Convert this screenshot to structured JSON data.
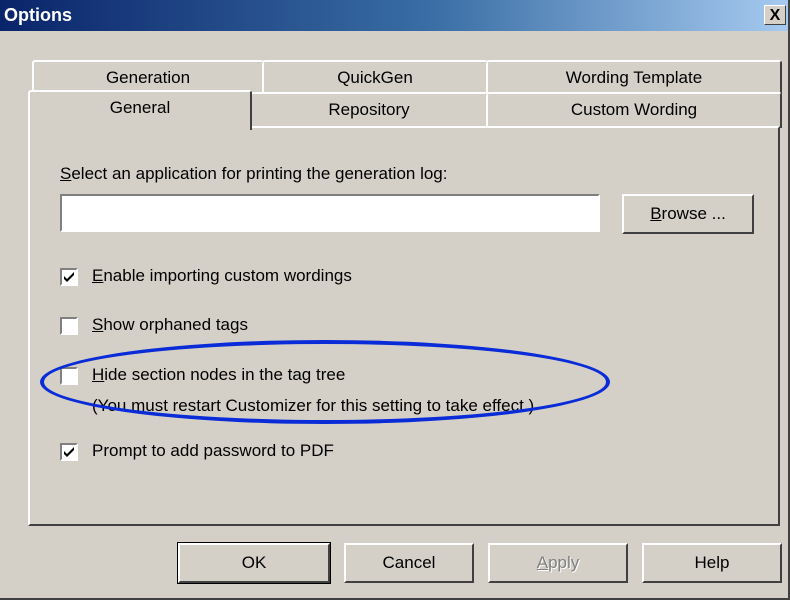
{
  "window": {
    "title": "Options",
    "close_label": "X"
  },
  "tabs": {
    "row1": [
      {
        "label": "Generation"
      },
      {
        "label": "QuickGen"
      },
      {
        "label": "Wording Template"
      }
    ],
    "row2": [
      {
        "label": "General",
        "active": true
      },
      {
        "label": "Repository"
      },
      {
        "label": "Custom Wording"
      }
    ]
  },
  "general": {
    "log_app": {
      "label_first": "S",
      "label_rest": "elect an application for printing the generation log:",
      "value": ""
    },
    "browse": {
      "first": "B",
      "rest": "rowse ..."
    },
    "options": [
      {
        "key": "E",
        "rest": "nable importing custom wordings",
        "checked": true
      },
      {
        "key": "S",
        "rest": "how orphaned tags",
        "checked": false
      },
      {
        "key": "H",
        "rest": "ide section nodes in the tag tree",
        "checked": false
      },
      {
        "key": "",
        "rest": "Prompt to add password to PDF",
        "checked": true
      }
    ],
    "restart_note": "(You must restart Customizer for this setting to take effect.)"
  },
  "buttons": {
    "ok": "OK",
    "cancel": "Cancel",
    "apply": {
      "first": "A",
      "rest": "pply"
    },
    "help": "Help"
  },
  "colors": {
    "title_start": "#0a246a",
    "title_end": "#a6caf0",
    "face": "#d4d0c8",
    "highlight": "#0a2bd8"
  }
}
